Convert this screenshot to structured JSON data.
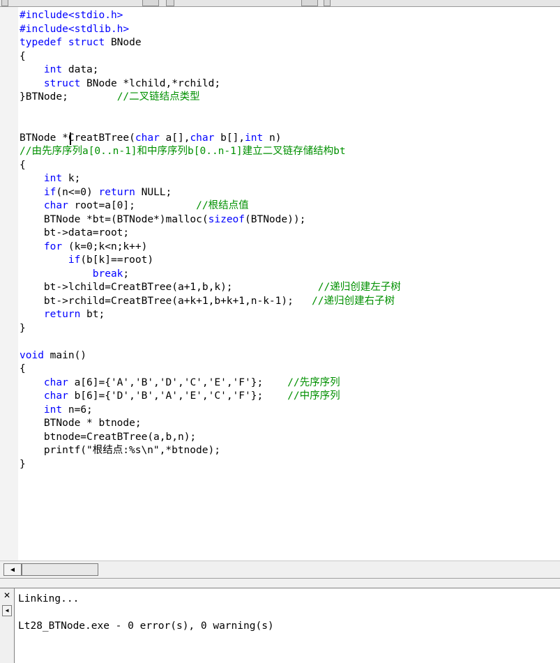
{
  "editor": {
    "lines": [
      [
        {
          "t": "#include<stdio.h>",
          "c": "keyword"
        }
      ],
      [
        {
          "t": "#include<stdlib.h>",
          "c": "keyword"
        }
      ],
      [
        {
          "t": "typedef struct",
          "c": "keyword"
        },
        {
          "t": " BNode",
          "c": "plain"
        }
      ],
      [
        {
          "t": "{",
          "c": "plain"
        }
      ],
      [
        {
          "t": "    ",
          "c": "plain"
        },
        {
          "t": "int",
          "c": "keyword"
        },
        {
          "t": " data;",
          "c": "plain"
        }
      ],
      [
        {
          "t": "    ",
          "c": "plain"
        },
        {
          "t": "struct",
          "c": "keyword"
        },
        {
          "t": " BNode *lchild,*rchild;",
          "c": "plain"
        }
      ],
      [
        {
          "t": "}BTNode;        ",
          "c": "plain"
        },
        {
          "t": "//二叉链结点类型",
          "c": "comment"
        }
      ],
      [],
      [],
      [
        {
          "t": "BTNode *CreatBTree(",
          "c": "plain"
        },
        {
          "t": "char",
          "c": "keyword"
        },
        {
          "t": " a[],",
          "c": "plain"
        },
        {
          "t": "char",
          "c": "keyword"
        },
        {
          "t": " b[],",
          "c": "plain"
        },
        {
          "t": "int",
          "c": "keyword"
        },
        {
          "t": " n)",
          "c": "plain"
        }
      ],
      [
        {
          "t": "//由先序序列a[0..n-1]和中序序列b[0..n-1]建立二叉链存储结构bt",
          "c": "comment"
        }
      ],
      [
        {
          "t": "{",
          "c": "plain"
        }
      ],
      [
        {
          "t": "    ",
          "c": "plain"
        },
        {
          "t": "int",
          "c": "keyword"
        },
        {
          "t": " k;",
          "c": "plain"
        }
      ],
      [
        {
          "t": "    ",
          "c": "plain"
        },
        {
          "t": "if",
          "c": "keyword"
        },
        {
          "t": "(n<=0) ",
          "c": "plain"
        },
        {
          "t": "return",
          "c": "keyword"
        },
        {
          "t": " NULL;",
          "c": "plain"
        }
      ],
      [
        {
          "t": "    ",
          "c": "plain"
        },
        {
          "t": "char",
          "c": "keyword"
        },
        {
          "t": " root=a[0];          ",
          "c": "plain"
        },
        {
          "t": "//根结点值",
          "c": "comment"
        }
      ],
      [
        {
          "t": "    BTNode *bt=(BTNode*)malloc(",
          "c": "plain"
        },
        {
          "t": "sizeof",
          "c": "keyword"
        },
        {
          "t": "(BTNode));",
          "c": "plain"
        }
      ],
      [
        {
          "t": "    bt->data=root;",
          "c": "plain"
        }
      ],
      [
        {
          "t": "    ",
          "c": "plain"
        },
        {
          "t": "for",
          "c": "keyword"
        },
        {
          "t": " (k=0;k<n;k++)",
          "c": "plain"
        }
      ],
      [
        {
          "t": "        ",
          "c": "plain"
        },
        {
          "t": "if",
          "c": "keyword"
        },
        {
          "t": "(b[k]==root)",
          "c": "plain"
        }
      ],
      [
        {
          "t": "            ",
          "c": "plain"
        },
        {
          "t": "break",
          "c": "keyword"
        },
        {
          "t": ";",
          "c": "plain"
        }
      ],
      [
        {
          "t": "    bt->lchild=CreatBTree(a+1,b,k);              ",
          "c": "plain"
        },
        {
          "t": "//递归创建左子树",
          "c": "comment"
        }
      ],
      [
        {
          "t": "    bt->rchild=CreatBTree(a+k+1,b+k+1,n-k-1);   ",
          "c": "plain"
        },
        {
          "t": "//递归创建右子树",
          "c": "comment"
        }
      ],
      [
        {
          "t": "    ",
          "c": "plain"
        },
        {
          "t": "return",
          "c": "keyword"
        },
        {
          "t": " bt;",
          "c": "plain"
        }
      ],
      [
        {
          "t": "}",
          "c": "plain"
        }
      ],
      [],
      [
        {
          "t": "void",
          "c": "keyword"
        },
        {
          "t": " main()",
          "c": "plain"
        }
      ],
      [
        {
          "t": "{",
          "c": "plain"
        }
      ],
      [
        {
          "t": "    ",
          "c": "plain"
        },
        {
          "t": "char",
          "c": "keyword"
        },
        {
          "t": " a[6]={'A','B','D','C','E','F'};    ",
          "c": "plain"
        },
        {
          "t": "//先序序列",
          "c": "comment"
        }
      ],
      [
        {
          "t": "    ",
          "c": "plain"
        },
        {
          "t": "char",
          "c": "keyword"
        },
        {
          "t": " b[6]={'D','B','A','E','C','F'};    ",
          "c": "plain"
        },
        {
          "t": "//中序序列",
          "c": "comment"
        }
      ],
      [
        {
          "t": "    ",
          "c": "plain"
        },
        {
          "t": "int",
          "c": "keyword"
        },
        {
          "t": " n=6;",
          "c": "plain"
        }
      ],
      [
        {
          "t": "    BTNode * btnode;",
          "c": "plain"
        }
      ],
      [
        {
          "t": "    btnode=CreatBTree(a,b,n);",
          "c": "plain"
        }
      ],
      [
        {
          "t": "    printf(\"根结点:%s\\n\",*btnode);",
          "c": "plain"
        }
      ],
      [
        {
          "t": "}",
          "c": "plain"
        }
      ]
    ]
  },
  "output": {
    "lines": [
      "Linking...",
      "",
      "Lt28_BTNode.exe - 0 error(s), 0 warning(s)"
    ]
  },
  "colors": {
    "keyword": "#0000ff",
    "comment": "#009000",
    "text": "#000000"
  },
  "icons": {
    "close": "close-icon",
    "scroll_left": "arrow-left-icon"
  }
}
